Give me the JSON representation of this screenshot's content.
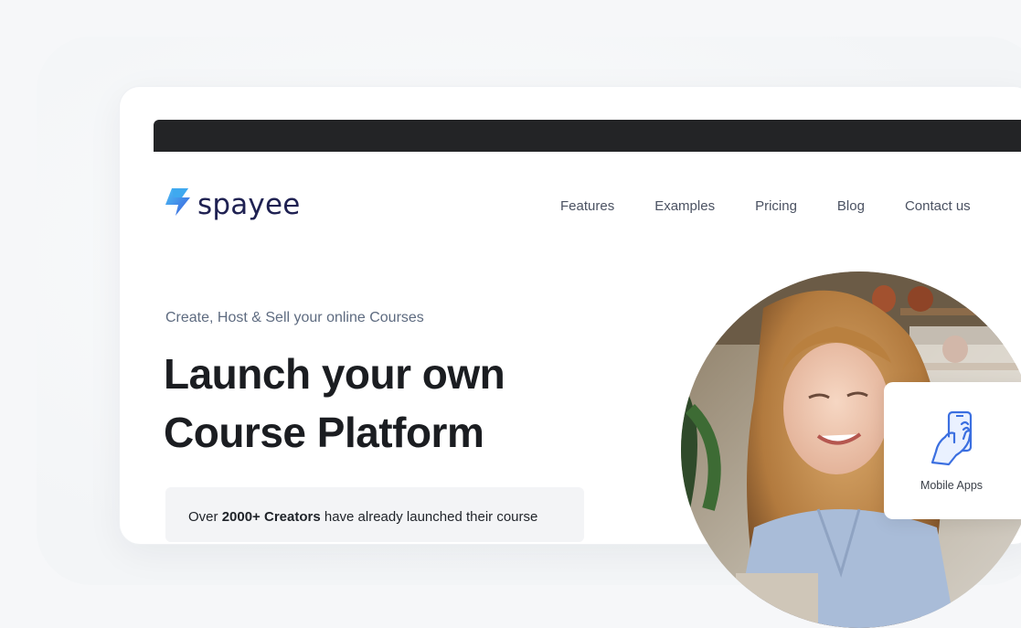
{
  "brand": {
    "name": "spayee",
    "accent": "#3b5bdb",
    "text_color": "#1f2152"
  },
  "nav": {
    "items": [
      {
        "label": "Features"
      },
      {
        "label": "Examples"
      },
      {
        "label": "Pricing"
      },
      {
        "label": "Blog"
      },
      {
        "label": "Contact us"
      }
    ]
  },
  "hero": {
    "eyebrow": "Create, Host & Sell your online Courses",
    "headline_line1": "Launch your own",
    "headline_line2": "Course Platform",
    "creators_prefix": "Over ",
    "creators_count": "2000+ Creators",
    "creators_suffix": " have already launched their course"
  },
  "feature_badge": {
    "label": "Mobile Apps",
    "icon": "mobile-app-hand-icon"
  },
  "colors": {
    "topbar": "#232426",
    "icon_blue": "#3b6fe0"
  }
}
